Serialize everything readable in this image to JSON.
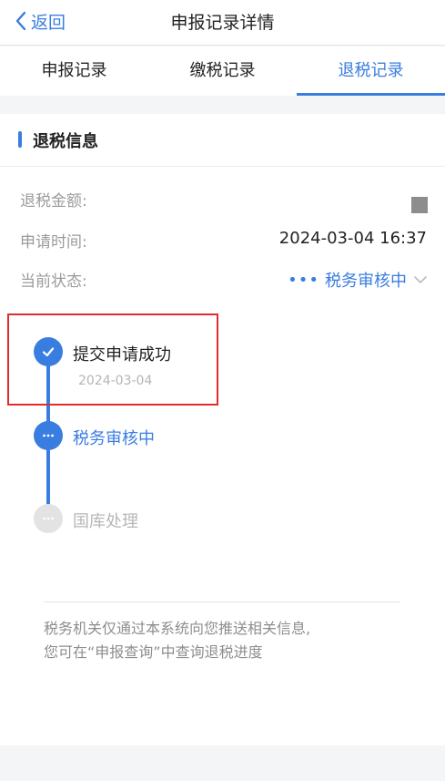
{
  "navbar": {
    "back_label": "返回",
    "title": "申报记录详情"
  },
  "tabs": [
    {
      "label": "申报记录",
      "active": false
    },
    {
      "label": "缴税记录",
      "active": false
    },
    {
      "label": "退税记录",
      "active": true
    }
  ],
  "section": {
    "title": "退税信息"
  },
  "info": {
    "amount_label": "退税金额:",
    "time_label": "申请时间:",
    "time_value": "2024-03-04 16:37",
    "status_label": "当前状态:",
    "status_value": "税务审核中"
  },
  "timeline": [
    {
      "title": "提交申请成功",
      "date": "2024-03-04",
      "state": "done"
    },
    {
      "title": "税务审核中",
      "state": "active"
    },
    {
      "title": "国库处理",
      "state": "pending"
    }
  ],
  "note": {
    "line1": "税务机关仅通过本系统向您推送相关信息,",
    "line2": "您可在“申报查询”中查询退税进度"
  },
  "colors": {
    "accent": "#3a7de0",
    "highlight": "#e02c2c",
    "pending": "#e3e3e3"
  }
}
